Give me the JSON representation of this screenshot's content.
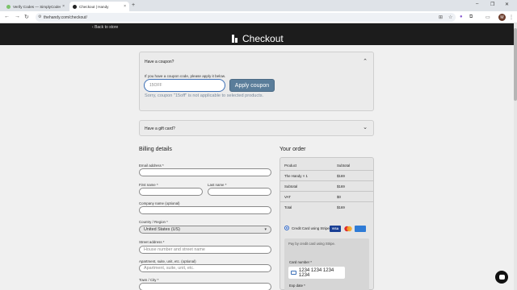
{
  "browser": {
    "tabs": [
      {
        "label": "Verify Codes — SimplyCodes",
        "favicon_color": "#7bc36a"
      },
      {
        "label": "Checkout | Handy",
        "favicon_color": "#222222"
      }
    ],
    "url": "thehandy.com/checkout/",
    "profile_initial": "M"
  },
  "header": {
    "back_label": "Back to store",
    "title": "Checkout"
  },
  "coupon": {
    "title": "Have a coupon?",
    "hint": "If you have a coupon code, please apply it below.",
    "input_value": "15OFF",
    "apply_label": "Apply coupon",
    "error": "Sorry, coupon \"15off\" is not applicable to selected products."
  },
  "gift_card": {
    "title": "Have a gift card?"
  },
  "billing": {
    "heading": "Billing details",
    "email_label": "Email address *",
    "first_name_label": "First name *",
    "last_name_label": "Last name *",
    "company_label": "Company name (optional)",
    "country_label": "Country / Region *",
    "country_value": "United States (US)",
    "street_label": "Street address *",
    "street_placeholder": "House number and street name",
    "apartment_label": "Apartment, suite, unit, etc. (optional)",
    "apartment_placeholder": "Apartment, suite, unit, etc.",
    "town_label": "Town / City *"
  },
  "order": {
    "heading": "Your order",
    "columns": [
      "Product",
      "Subtotal"
    ],
    "rows": [
      {
        "label": "The Handy  × 1",
        "value": "$169"
      },
      {
        "label": "Subtotal",
        "value": "$169"
      },
      {
        "label": "VAT",
        "value": "$0"
      },
      {
        "label": "Total",
        "value": "$169"
      }
    ],
    "payment_method": "Credit Card using Stripe",
    "card_brands": [
      "VISA",
      "MC",
      "AMEX"
    ],
    "stripe_note": "Pay by credit card using Stripe.",
    "card_number_label": "Card number *",
    "card_number_placeholder": "1234 1234 1234 1234",
    "expiry_label": "Exp date *"
  }
}
